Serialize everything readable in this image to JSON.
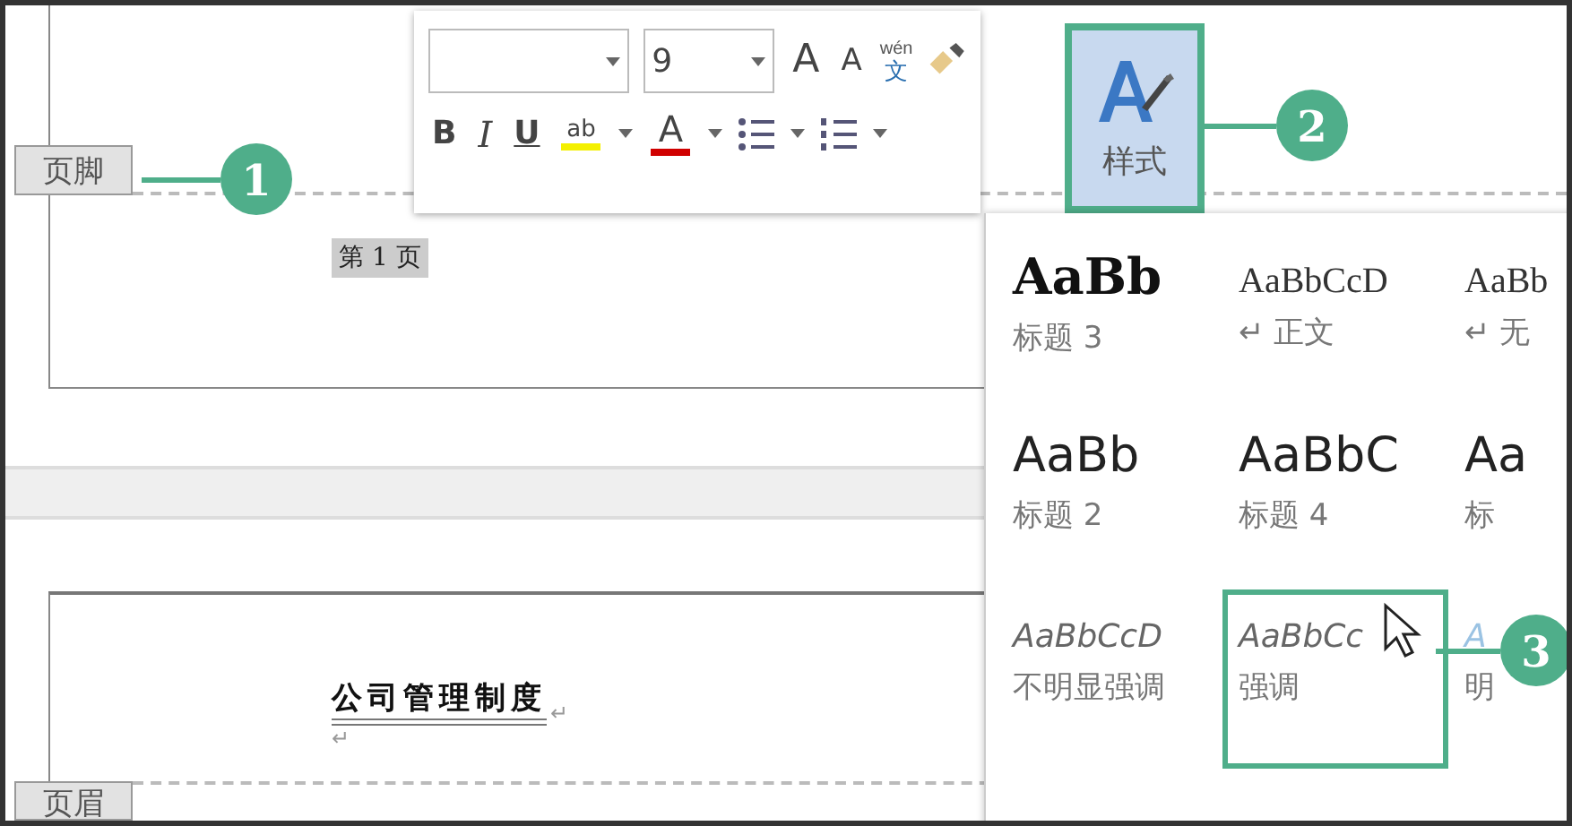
{
  "document": {
    "footer_label": "页脚",
    "page_number": "第 1 页",
    "heading": "公司管理制度",
    "paragraph_mark": "↵",
    "header_label": "页眉"
  },
  "mini_toolbar": {
    "font_size": "9",
    "grow_font": "A",
    "shrink_font": "A",
    "phonetic_top": "wén",
    "phonetic_bottom": "文",
    "bold": "B",
    "italic": "I",
    "underline": "U",
    "highlight": "ab",
    "font_color": "A",
    "styles_button": {
      "label": "样式",
      "selected": true
    }
  },
  "styles_gallery": {
    "rows": [
      [
        {
          "preview": "AaBb",
          "label": "标题 3",
          "kind": "serif-bold",
          "selected": false
        },
        {
          "preview": "AaBbCcD",
          "label": "↵ 正文",
          "kind": "serif",
          "selected": false
        },
        {
          "preview": "AaBb",
          "label": "↵ 无",
          "kind": "serif",
          "selected": false
        }
      ],
      [
        {
          "preview": "AaBb",
          "label": "标题 2",
          "kind": "sans",
          "selected": false
        },
        {
          "preview": "AaBbC",
          "label": "标题 4",
          "kind": "sans",
          "selected": false
        },
        {
          "preview": "Aa",
          "label": "标",
          "kind": "sans",
          "selected": false
        }
      ],
      [
        {
          "preview": "AaBbCcD",
          "label": "不明显强调",
          "kind": "italic",
          "selected": false
        },
        {
          "preview": "AaBbCc",
          "label": "强调",
          "kind": "italic",
          "selected": true
        },
        {
          "preview": "A",
          "label": "明",
          "kind": "italic-faint",
          "selected": false
        }
      ]
    ]
  },
  "callouts": [
    "1",
    "2",
    "3"
  ]
}
